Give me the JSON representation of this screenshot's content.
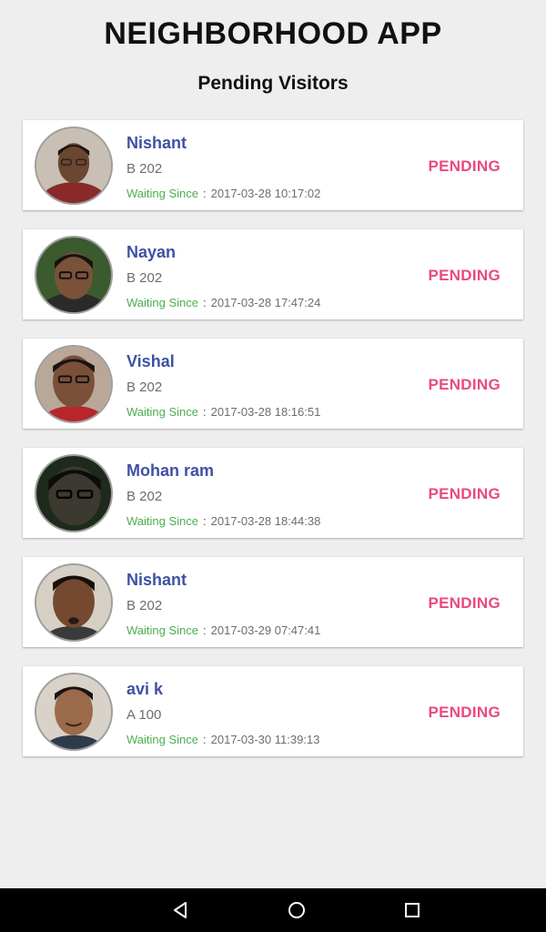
{
  "app_title": "NEIGHBORHOOD APP",
  "section_title": "Pending Visitors",
  "waiting_label": "Waiting Since",
  "waiting_separator": ":",
  "colors": {
    "name": "#3f51a5",
    "waiting_label": "#4caf50",
    "status": "#e84a80",
    "background": "#eeeeee",
    "navbar": "#000000"
  },
  "visitors": [
    {
      "name": "Nishant",
      "flat": "B 202",
      "waiting_since": "2017-03-28 10:17:02",
      "status": "PENDING",
      "avatar": "visitor-photo"
    },
    {
      "name": "Nayan",
      "flat": "B 202",
      "waiting_since": "2017-03-28 17:47:24",
      "status": "PENDING",
      "avatar": "visitor-photo"
    },
    {
      "name": "Vishal",
      "flat": "B 202",
      "waiting_since": "2017-03-28 18:16:51",
      "status": "PENDING",
      "avatar": "visitor-photo"
    },
    {
      "name": "Mohan ram",
      "flat": "B 202",
      "waiting_since": "2017-03-28 18:44:38",
      "status": "PENDING",
      "avatar": "visitor-photo"
    },
    {
      "name": "Nishant",
      "flat": "B 202",
      "waiting_since": "2017-03-29 07:47:41",
      "status": "PENDING",
      "avatar": "visitor-photo"
    },
    {
      "name": "avi k",
      "flat": "A 100",
      "waiting_since": "2017-03-30 11:39:13",
      "status": "PENDING",
      "avatar": "visitor-photo"
    }
  ],
  "navbar": {
    "back_icon": "back-triangle-icon",
    "home_icon": "home-circle-icon",
    "recents_icon": "recents-square-icon"
  }
}
